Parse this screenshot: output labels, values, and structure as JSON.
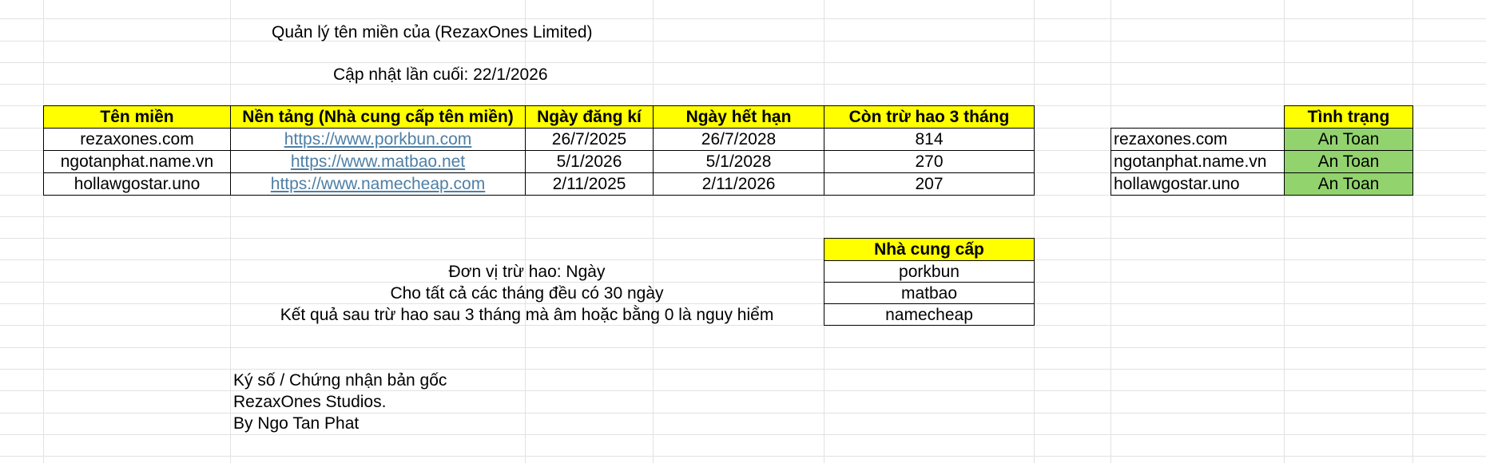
{
  "header": {
    "title": "Quản lý tên miền của (RezaxOnes Limited)",
    "last_updated": "Cập nhật lần cuối: 22/1/2026"
  },
  "domains_table": {
    "columns": [
      "Tên miền",
      "Nền tảng (Nhà cung cấp tên miền)",
      "Ngày đăng kí",
      "Ngày hết hạn",
      "Còn trừ hao 3 tháng"
    ],
    "rows": [
      {
        "domain": "rezaxones.com",
        "platform": "https://www.porkbun.com",
        "registered": "26/7/2025",
        "expires": "26/7/2028",
        "remaining": "814"
      },
      {
        "domain": "ngotanphat.name.vn",
        "platform": "https://www.matbao.net",
        "registered": "5/1/2026",
        "expires": "5/1/2028",
        "remaining": "270"
      },
      {
        "domain": "hollawgostar.uno",
        "platform": "https://www.namecheap.com",
        "registered": "2/11/2025",
        "expires": "2/11/2026",
        "remaining": "207"
      }
    ]
  },
  "status_table": {
    "header": "Tình trạng",
    "rows": [
      {
        "domain": "rezaxones.com",
        "status": "An Toan"
      },
      {
        "domain": "ngotanphat.name.vn",
        "status": "An Toan"
      },
      {
        "domain": "hollawgostar.uno",
        "status": "An Toan"
      }
    ],
    "status_color": "#92d36e"
  },
  "notes": [
    "Đơn vị trừ hao: Ngày",
    "Cho tất cả các tháng đều có 30 ngày",
    "Kết quả sau trừ hao sau 3 tháng mà âm hoặc bằng 0 là nguy hiểm"
  ],
  "providers_table": {
    "header": "Nhà cung cấp",
    "items": [
      "porkbun",
      "matbao",
      "namecheap"
    ]
  },
  "signature": [
    "Ký số / Chứng nhận bản gốc",
    "RezaxOnes Studios.",
    "By Ngo Tan Phat"
  ],
  "colors": {
    "header_fill": "#ffff00",
    "link": "#4d7fa6",
    "gridline": "#e2e2e2"
  }
}
